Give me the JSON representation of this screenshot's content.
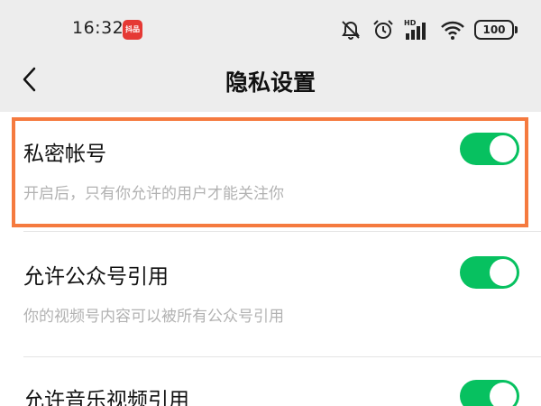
{
  "status_bar": {
    "time": "16:32",
    "app_badge": "抖品",
    "network": "HD",
    "battery": "100",
    "icons": [
      "mute-icon",
      "alarm-icon",
      "signal-icon",
      "wifi-icon",
      "battery-icon"
    ]
  },
  "nav": {
    "title": "隐私设置",
    "back_icon": "chevron-left-icon"
  },
  "settings": [
    {
      "title": "私密帐号",
      "description": "开启后，只有你允许的用户才能关注你",
      "enabled": true
    },
    {
      "title": "允许公众号引用",
      "description": "你的视频号内容可以被所有公众号引用",
      "enabled": true
    },
    {
      "title": "允许音乐视频引用",
      "description": "",
      "enabled": true
    }
  ],
  "colors": {
    "toggle_on": "#07c160",
    "highlight": "#f57a3f",
    "background": "#ededed"
  }
}
